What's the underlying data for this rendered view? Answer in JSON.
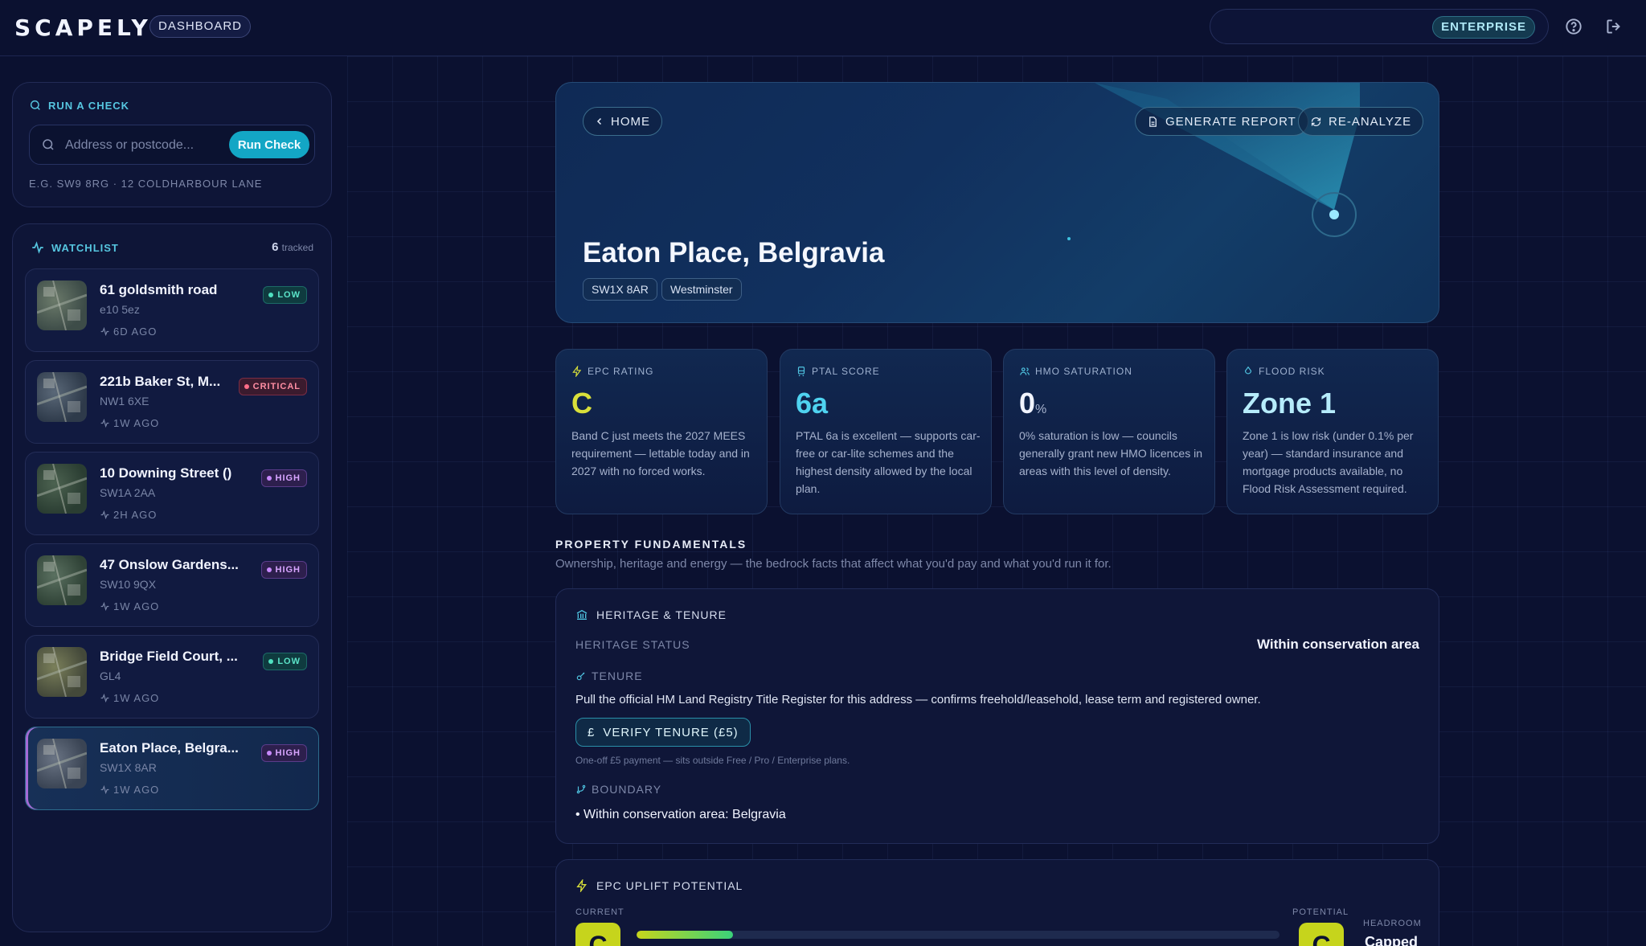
{
  "header": {
    "logo": "SCAPELY",
    "section_label": "DASHBOARD",
    "plan_badge": "ENTERPRISE",
    "icons": [
      "help-circle-icon",
      "logout-icon"
    ]
  },
  "run_check": {
    "title": "RUN A CHECK",
    "placeholder": "Address or postcode...",
    "button": "Run Check",
    "hint": "E.G. SW9 8RG · 12 COLDHARBOUR LANE"
  },
  "watchlist": {
    "title": "WATCHLIST",
    "count": "6",
    "count_suffix": "tracked",
    "items": [
      {
        "name": "61 goldsmith road",
        "code": "e10 5ez",
        "ago": "6D AGO",
        "badge": "LOW",
        "level": "low"
      },
      {
        "name": "221b Baker St, M...",
        "code": "NW1 6XE",
        "ago": "1W AGO",
        "badge": "CRITICAL",
        "level": "crit"
      },
      {
        "name": "10 Downing Street ()",
        "code": "SW1A 2AA",
        "ago": "2H AGO",
        "badge": "HIGH",
        "level": "high"
      },
      {
        "name": "47 Onslow Gardens...",
        "code": "SW10 9QX",
        "ago": "1W AGO",
        "badge": "HIGH",
        "level": "high"
      },
      {
        "name": "Bridge Field Court, ...",
        "code": "GL4",
        "ago": "1W AGO",
        "badge": "LOW",
        "level": "low"
      },
      {
        "name": "Eaton Place, Belgra...",
        "code": "SW1X 8AR",
        "ago": "1W AGO",
        "badge": "HIGH",
        "level": "high"
      }
    ]
  },
  "hero": {
    "home": "HOME",
    "generate_report": "GENERATE REPORT",
    "reanalyze": "RE-ANALYZE",
    "title": "Eaton Place, Belgravia",
    "postcode": "SW1X 8AR",
    "borough": "Westminster"
  },
  "metrics": [
    {
      "label": "EPC RATING",
      "value": "C",
      "unit": "",
      "desc": "Band C just meets the 2027 MEES requirement — lettable today and in 2027 with no forced works.",
      "color": "#d9e03a",
      "icon": "lightning-icon"
    },
    {
      "label": "PTAL SCORE",
      "value": "6a",
      "unit": "",
      "desc": "PTAL 6a is excellent — supports car-free or car-lite schemes and the highest density allowed by the local plan.",
      "color": "#4fd3f0",
      "icon": "train-icon"
    },
    {
      "label": "HMO SATURATION",
      "value": "0",
      "unit": "%",
      "desc": "0% saturation is low — councils generally grant new HMO licences in areas with this level of density.",
      "color": "#f1f4ff",
      "icon": "users-icon"
    },
    {
      "label": "FLOOD RISK",
      "value": "Zone 1",
      "unit": "",
      "desc": "Zone 1 is low risk (under 0.1% per year) — standard insurance and mortgage products available, no Flood Risk Assessment required.",
      "color": "#b6ecfb",
      "icon": "droplet-icon"
    }
  ],
  "fundamentals": {
    "title": "PROPERTY FUNDAMENTALS",
    "subtitle": "Ownership, heritage and energy — the bedrock facts that affect what you'd pay and what you'd run it for.",
    "heritage_card": {
      "title": "HERITAGE & TENURE",
      "heritage_label": "HERITAGE STATUS",
      "heritage_value": "Within conservation area",
      "tenure_label": "TENURE",
      "tenure_text": "Pull the official HM Land Registry Title Register for this address — confirms freehold/leasehold, lease term and registered owner.",
      "verify_button": "VERIFY TENURE (£5)",
      "verify_note": "One-off £5 payment — sits outside Free / Pro / Enterprise plans.",
      "boundary_label": "BOUNDARY",
      "boundary_item": "• Within conservation area: Belgravia"
    },
    "epc_card": {
      "title": "EPC UPLIFT POTENTIAL",
      "current_label": "CURRENT",
      "current_grade": "C",
      "potential_label": "POTENTIAL",
      "potential_grade": "C",
      "headroom_label": "HEADROOM",
      "headroom_value": "Capped",
      "progress": 0.15
    }
  }
}
